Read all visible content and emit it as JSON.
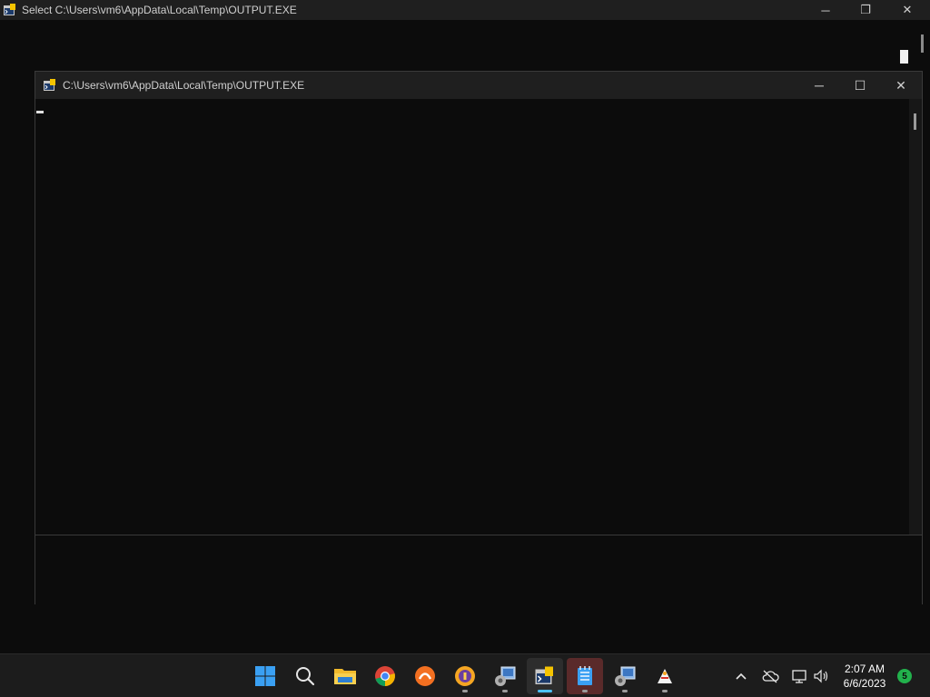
{
  "background_window": {
    "title": "Select C:\\Users\\vm6\\AppData\\Local\\Temp\\OUTPUT.EXE",
    "icon": "console-app-icon",
    "minimize_label": "─",
    "restore_label": "❐",
    "close_label": "✕"
  },
  "foreground_window": {
    "title": "C:\\Users\\vm6\\AppData\\Local\\Temp\\OUTPUT.EXE",
    "icon": "console-app-icon",
    "minimize_label": "─",
    "maximize_label": "☐",
    "close_label": "✕"
  },
  "taskbar": {
    "apps": [
      {
        "name": "start-button",
        "icon": "windows-logo-icon"
      },
      {
        "name": "search-button",
        "icon": "search-icon"
      },
      {
        "name": "file-explorer",
        "icon": "folder-icon"
      },
      {
        "name": "chrome",
        "icon": "chrome-icon"
      },
      {
        "name": "app-orange",
        "icon": "orange-app-icon"
      },
      {
        "name": "app-shield",
        "icon": "shield-app-icon"
      },
      {
        "name": "app-install-1",
        "icon": "installer-icon"
      },
      {
        "name": "app-console",
        "icon": "console-app-icon"
      },
      {
        "name": "app-notepad",
        "icon": "notepad-icon"
      },
      {
        "name": "app-install-2",
        "icon": "installer-icon"
      },
      {
        "name": "app-tool",
        "icon": "tool-app-icon"
      }
    ],
    "tray": {
      "chevron": "^",
      "onedrive": "cloud-off-icon",
      "network": "network-icon",
      "volume": "volume-icon"
    },
    "time": "2:07 AM",
    "date": "6/6/2023",
    "notification_count": "5",
    "colors": {
      "accent": "#4cc2ff",
      "notification": "#22b14c"
    }
  }
}
